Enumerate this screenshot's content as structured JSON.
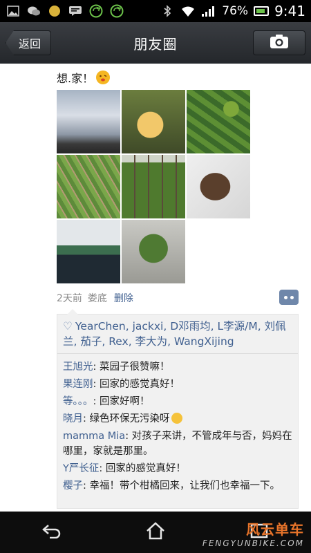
{
  "status_bar": {
    "battery_percent": "76%",
    "time": "9:41",
    "icons": [
      "gallery-icon",
      "wechat-icon",
      "coin-icon",
      "message-icon",
      "sync-icon",
      "sync-icon",
      "bluetooth-icon",
      "wifi-icon",
      "signal-icon",
      "battery-icon"
    ]
  },
  "title_bar": {
    "back_label": "返回",
    "title": "朋友圈",
    "camera_icon": "camera-icon"
  },
  "post": {
    "text": "想.家！",
    "emoji": "tongue-out-face",
    "time": "2天前",
    "place": "娄底",
    "delete_label": "删除",
    "photo_count": 8
  },
  "likes": {
    "names": "YearChen, jackxi, D邓雨均, L李源/M, 刘佩兰, 茄子, Rex, 李大为, WangXijing"
  },
  "comments": [
    {
      "name": "王旭光",
      "text": ": 菜园子很赞嘛！"
    },
    {
      "name": "果连刚",
      "text": ": 回家的感觉真好！"
    },
    {
      "name": "等。。。",
      "text": ": 回家好啊！"
    },
    {
      "name": "晓月",
      "text": ": 绿色环保无污染呀"
    },
    {
      "name": "mamma Mia",
      "text": ": 对孩子来讲，不管成年与否，妈妈在哪里，家就是那里。"
    },
    {
      "name": "Y严长征",
      "text": ": 回家的感觉真好！"
    },
    {
      "name": "樱子",
      "text": ": 幸福！带个柑橘回来，让我们也幸福一下。"
    }
  ],
  "watermark": {
    "cn": "风云单车",
    "en": "FENGYUNBIKE.COM"
  },
  "colors": {
    "link_blue": "#3f5f8f",
    "title_bar_bg": "#2c2f33",
    "panel_bg": "#f1f1f1"
  }
}
